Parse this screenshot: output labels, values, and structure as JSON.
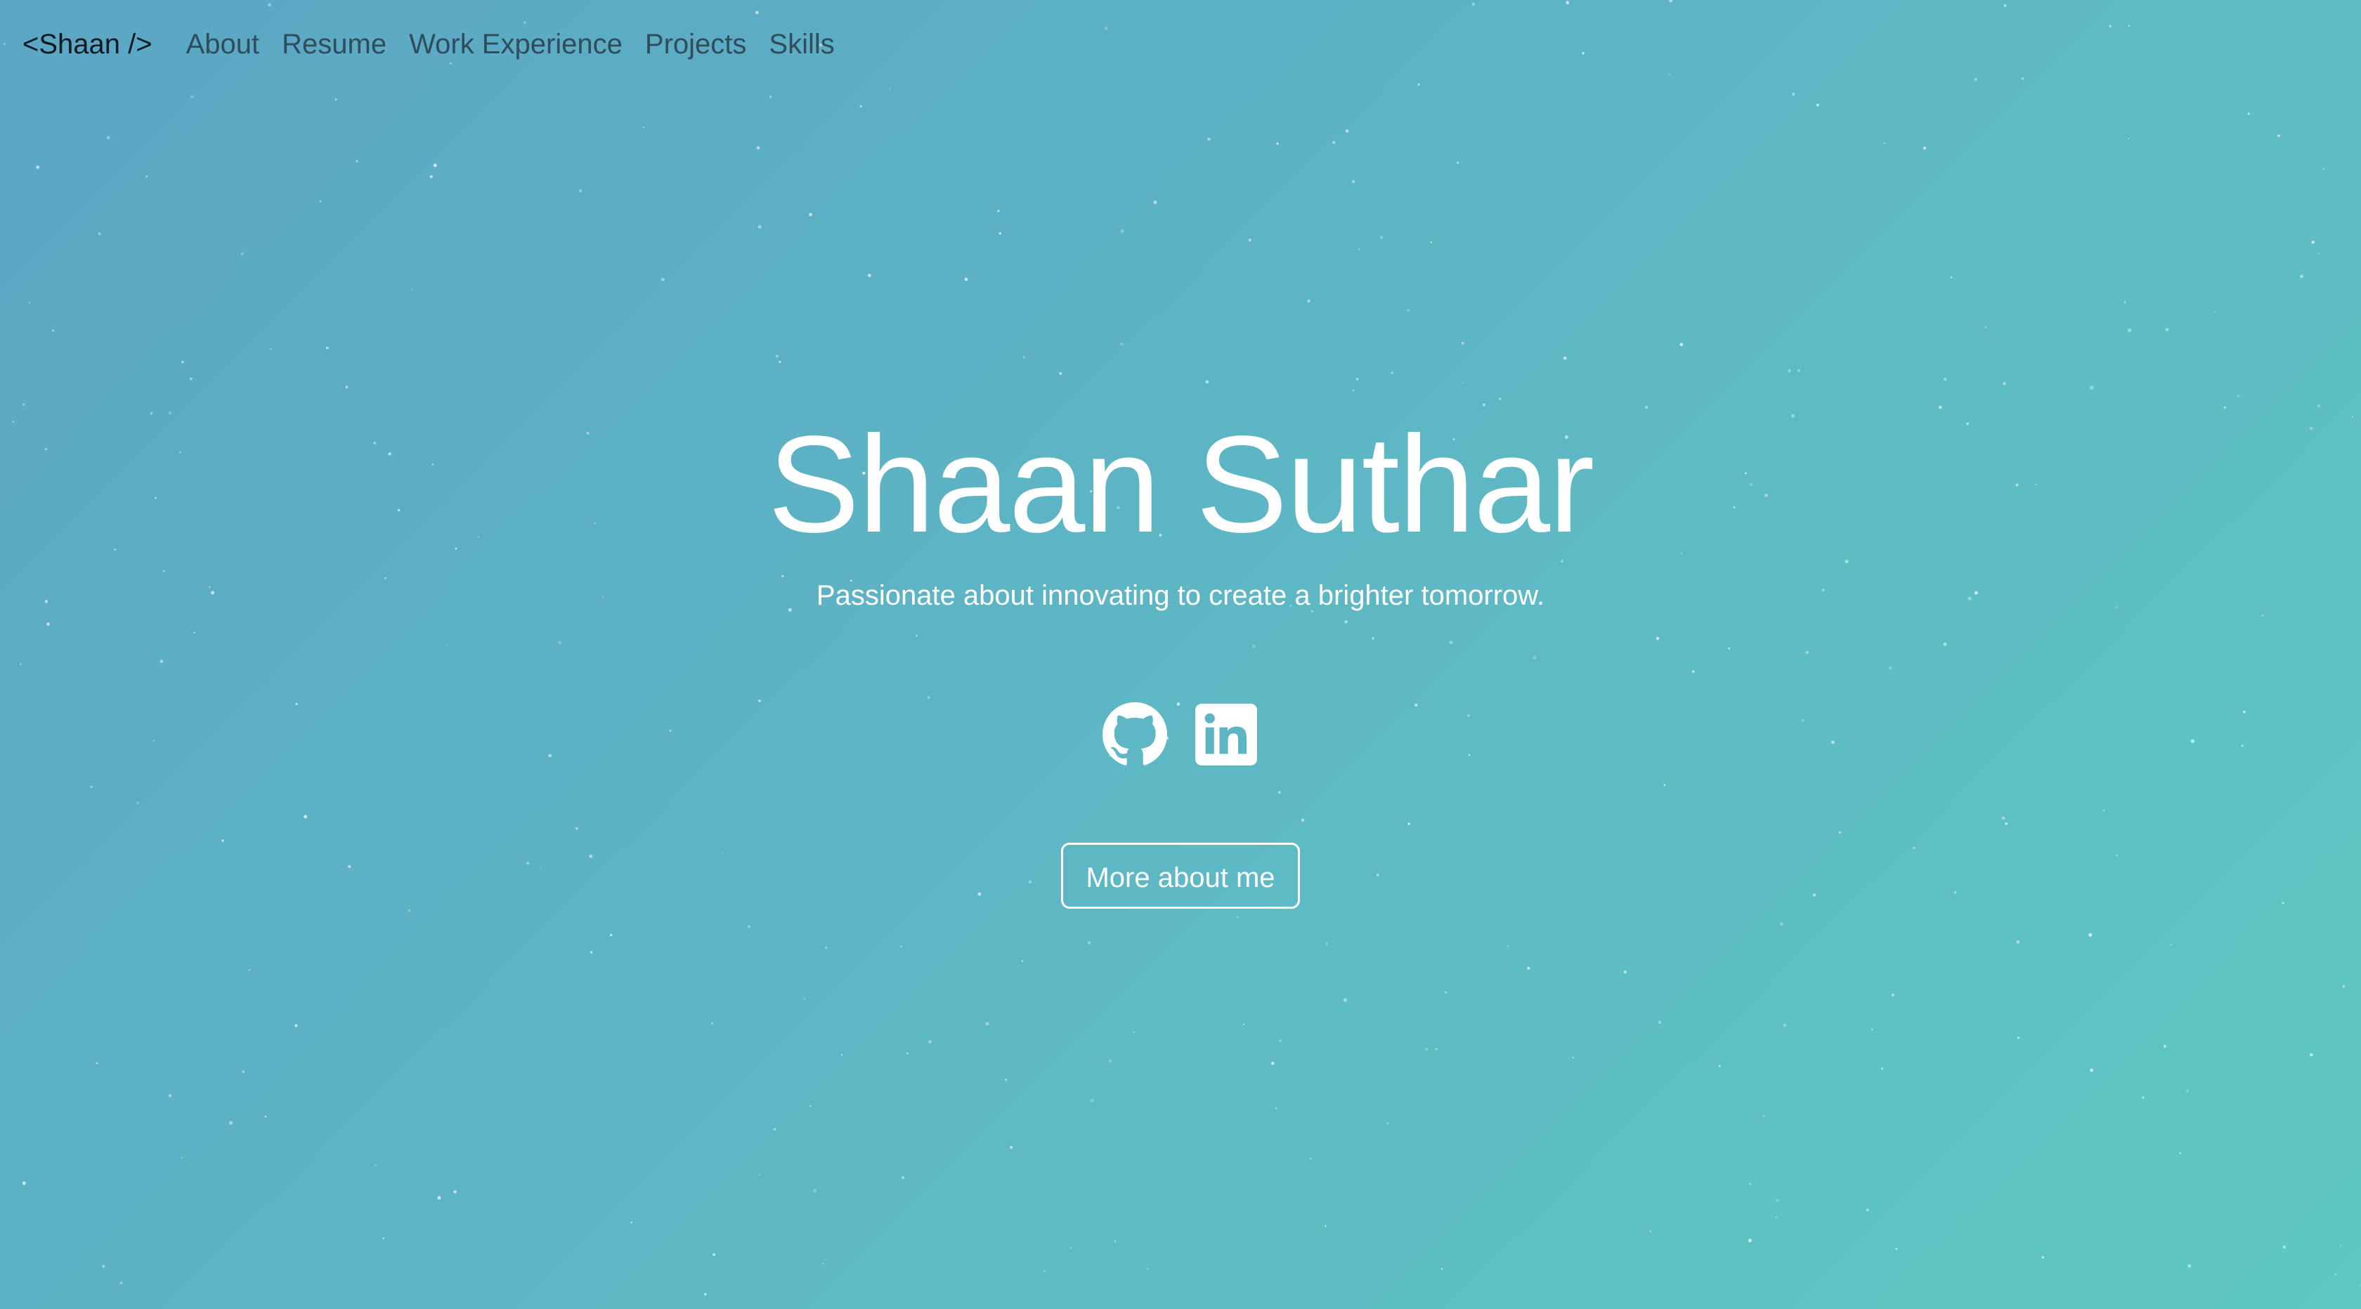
{
  "nav": {
    "brand": "<Shaan />",
    "links": [
      "About",
      "Resume",
      "Work Experience",
      "Projects",
      "Skills"
    ]
  },
  "hero": {
    "title": "Shaan Suthar",
    "subtitle": "Passionate about innovating to create a brighter tomorrow.",
    "cta_label": "More about me"
  },
  "social": {
    "icons": [
      "github-icon",
      "linkedin-icon"
    ]
  },
  "colors": {
    "background_start": "#5ba6c4",
    "background_end": "#5fc8c2",
    "text": "#ffffff",
    "brand_text": "#0d1b24",
    "nav_text": "#2f4d5c"
  }
}
